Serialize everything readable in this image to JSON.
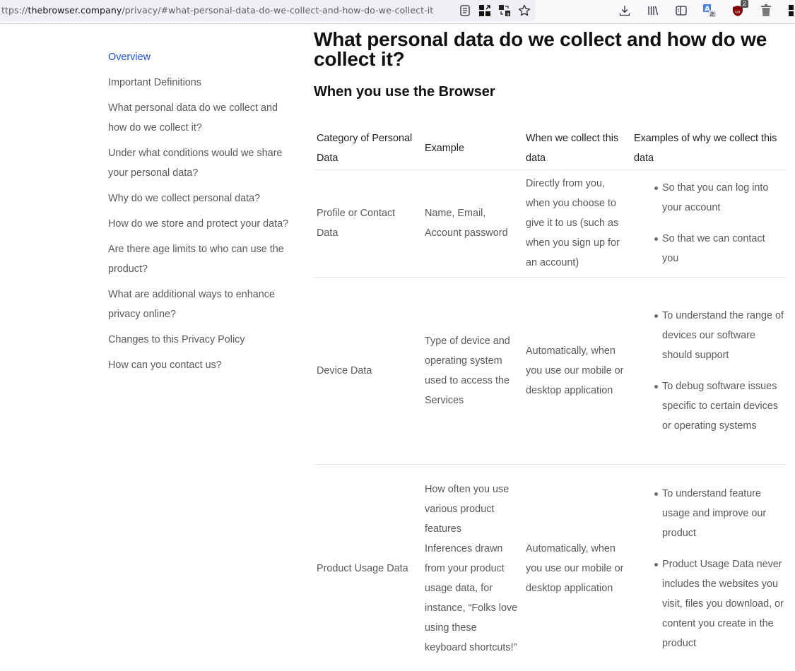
{
  "browser": {
    "url_prefix": "ttps://",
    "url_host": "thebrowser.company",
    "url_path": "/privacy/#what-personal-data-do-we-collect-and-how-do-we-collect-it",
    "url_icons": [
      "reader-view-icon",
      "qr-code-icon",
      "translate-page-icon",
      "bookmark-star-icon"
    ],
    "toolbar_icons": [
      "download-icon",
      "library-icon",
      "sidebar-icon",
      "translate-extension-icon",
      "ublock-icon",
      "trash-icon",
      "extensions-icon"
    ],
    "ublock_badge": "2"
  },
  "sidebar": {
    "items": [
      {
        "label": "Overview",
        "active": true
      },
      {
        "label": "Important Definitions"
      },
      {
        "label": "What personal data do we collect and how do we collect it?"
      },
      {
        "label": "Under what conditions would we share your personal data?"
      },
      {
        "label": "Why do we collect personal data?"
      },
      {
        "label": "How do we store and protect your data?"
      },
      {
        "label": "Are there age limits to who can use the product?"
      },
      {
        "label": "What are additional ways to enhance privacy online?"
      },
      {
        "label": "Changes to this Privacy Policy"
      },
      {
        "label": "How can you contact us?"
      }
    ]
  },
  "main": {
    "title": "What personal data do we collect and how do we collect it?",
    "subtitle": "When you use the Browser",
    "table": {
      "headers": [
        "Category of Personal Data",
        "Example",
        "When we collect this data",
        "Examples of why we collect this data"
      ],
      "rows": [
        {
          "category": "Profile or Contact Data",
          "examples": [
            "Name, Email, Account password"
          ],
          "when": "Directly from you, when you choose to give it to us (such as when you sign up for an account)",
          "why": [
            "So that you can log into your account",
            "So that we can contact you"
          ]
        },
        {
          "category": "Device Data",
          "examples": [
            "Type of device and operating system used to access the Services"
          ],
          "when": "Automatically, when you use our mobile or desktop application",
          "why": [
            "To understand the range of devices our software should support",
            "To debug software issues specific to certain devices or operating systems"
          ]
        },
        {
          "category": "Product Usage Data",
          "examples": [
            "How often you use various product features",
            "Inferences drawn from your product usage data, for instance, “Folks love using these keyboard shortcuts!”"
          ],
          "when": "Automatically, when you use our mobile or desktop application",
          "why": [
            "To understand feature usage and improve our product",
            "Product Usage Data never includes the websites you visit, files you download, or content you create in the product"
          ]
        }
      ]
    }
  },
  "colors": {
    "link_active": "#1a4fd6",
    "text_muted": "#595959",
    "heading": "#111111",
    "ublock_red": "#800000"
  }
}
